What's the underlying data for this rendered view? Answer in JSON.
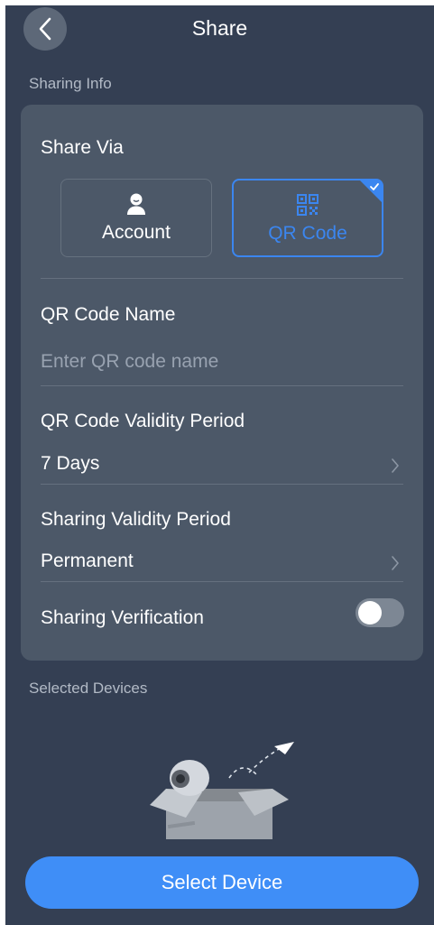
{
  "header": {
    "title": "Share",
    "back_icon": "chevron-left-icon"
  },
  "sharing_info": {
    "section_label": "Sharing Info",
    "share_via": {
      "label": "Share Via",
      "options": [
        {
          "label": "Account",
          "icon": "user-icon",
          "selected": false
        },
        {
          "label": "QR Code",
          "icon": "qr-code-icon",
          "selected": true
        }
      ]
    },
    "qr_code_name": {
      "label": "QR Code Name",
      "placeholder": "Enter QR code name",
      "value": ""
    },
    "qr_validity": {
      "label": "QR Code Validity Period",
      "value": "7 Days"
    },
    "sharing_validity": {
      "label": "Sharing Validity Period",
      "value": "Permanent"
    },
    "sharing_verification": {
      "label": "Sharing Verification",
      "enabled": false
    }
  },
  "selected_devices": {
    "section_label": "Selected Devices",
    "illustration": "empty-box-camera-illustration"
  },
  "footer": {
    "select_button_label": "Select Device"
  },
  "colors": {
    "background": "#343f53",
    "card": "#4c5868",
    "accent": "#3f8ef7",
    "muted_text": "#b2bac6"
  }
}
